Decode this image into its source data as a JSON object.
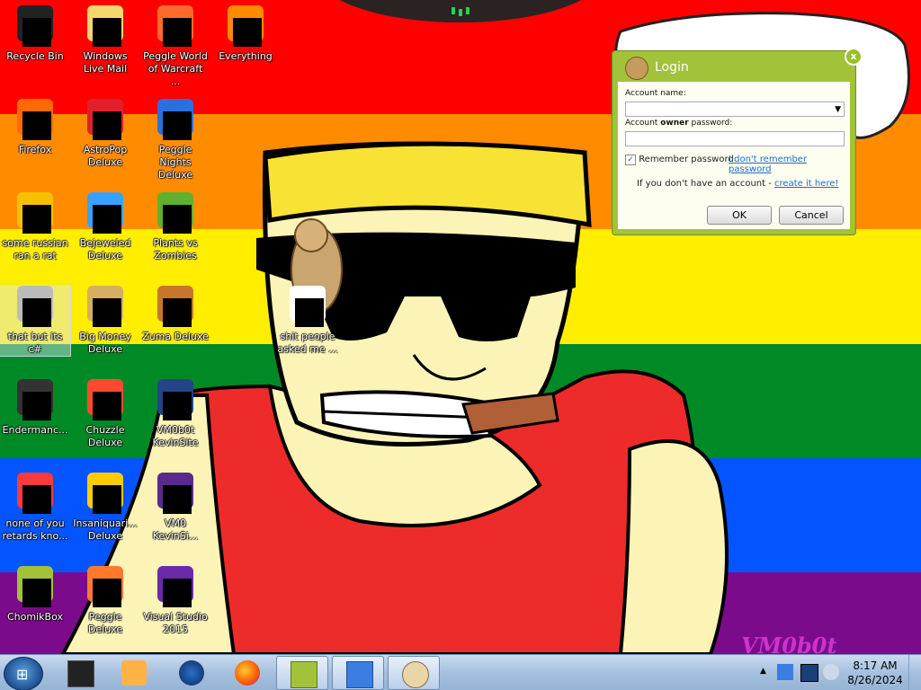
{
  "desktop": {
    "icons": [
      {
        "label": "Recycle Bin"
      },
      {
        "label": "Windows Live Mail"
      },
      {
        "label": "Peggle World of Warcraft ..."
      },
      {
        "label": "Everything"
      },
      {
        "label": "Firefox"
      },
      {
        "label": "AstroPop Deluxe"
      },
      {
        "label": "Peggle Nights Deluxe"
      },
      {
        "label": "some russian ran a rat"
      },
      {
        "label": "Bejeweled Deluxe"
      },
      {
        "label": "Plants vs Zombies"
      },
      {
        "label": "that but its c#"
      },
      {
        "label": "Big Money Deluxe"
      },
      {
        "label": "Zuma Deluxe"
      },
      {
        "label": "shit people asked me ..."
      },
      {
        "label": "Endermanc..."
      },
      {
        "label": "Chuzzle Deluxe"
      },
      {
        "label": "VM0b0t KevinSite"
      },
      {
        "label": "none of you retards kno..."
      },
      {
        "label": "Insaniquari... Deluxe"
      },
      {
        "label": "VM0 KevinSi..."
      },
      {
        "label": "ChomikBox"
      },
      {
        "label": "Peggle Deluxe"
      },
      {
        "label": "Visual Studio 2015"
      }
    ],
    "wallpaper_signature": "VM0b0t"
  },
  "login_dialog": {
    "title": "Login",
    "account_name_label": "Account name:",
    "password_label_prefix": "Account ",
    "password_label_bold": "owner",
    "password_label_suffix": " password:",
    "remember_label": "Remember password",
    "remember_checked": true,
    "forgot_link": "I don't remember password",
    "no_account_text": "If you don't have an account - ",
    "create_link": "create it here!",
    "ok_label": "OK",
    "cancel_label": "Cancel",
    "close_glyph": "x"
  },
  "taskbar": {
    "time": "8:17 AM",
    "date": "8/26/2024",
    "buttons": [
      "terminal-icon",
      "media-player-icon",
      "globe-icon",
      "firefox-icon",
      "chomikbox-icon",
      "installer-icon",
      "paint-icon"
    ],
    "tray_arrow": "▲"
  },
  "colors": {
    "red": "#fe0000",
    "orange": "#ff8c00",
    "yellow": "#ffee00",
    "green": "#008a26",
    "blue": "#0455ff",
    "purple": "#7b0b8a",
    "dialog_green": "#a2c23a"
  }
}
